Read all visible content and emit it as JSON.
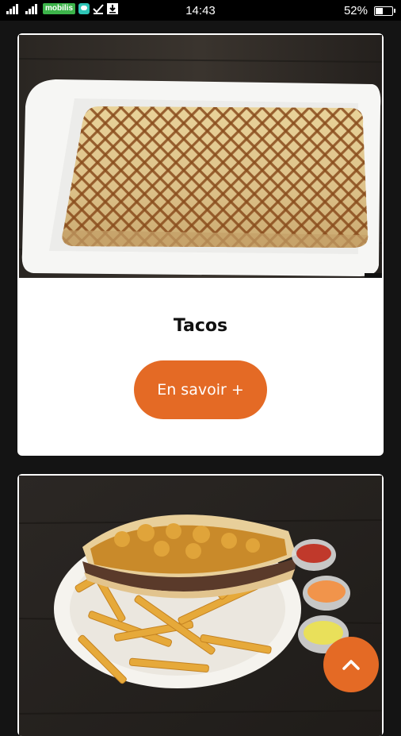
{
  "status_bar": {
    "carrier": "mobilis",
    "time": "14:43",
    "battery_percent": "52%",
    "battery_level": 0.52
  },
  "items": [
    {
      "title": "Tacos",
      "button_label": "En savoir +"
    },
    {
      "title": "",
      "button_label": ""
    }
  ],
  "colors": {
    "accent": "#e46a25",
    "background": "#141414",
    "card": "#ffffff"
  },
  "icons": {
    "scroll_top": "chevron-up-icon"
  }
}
